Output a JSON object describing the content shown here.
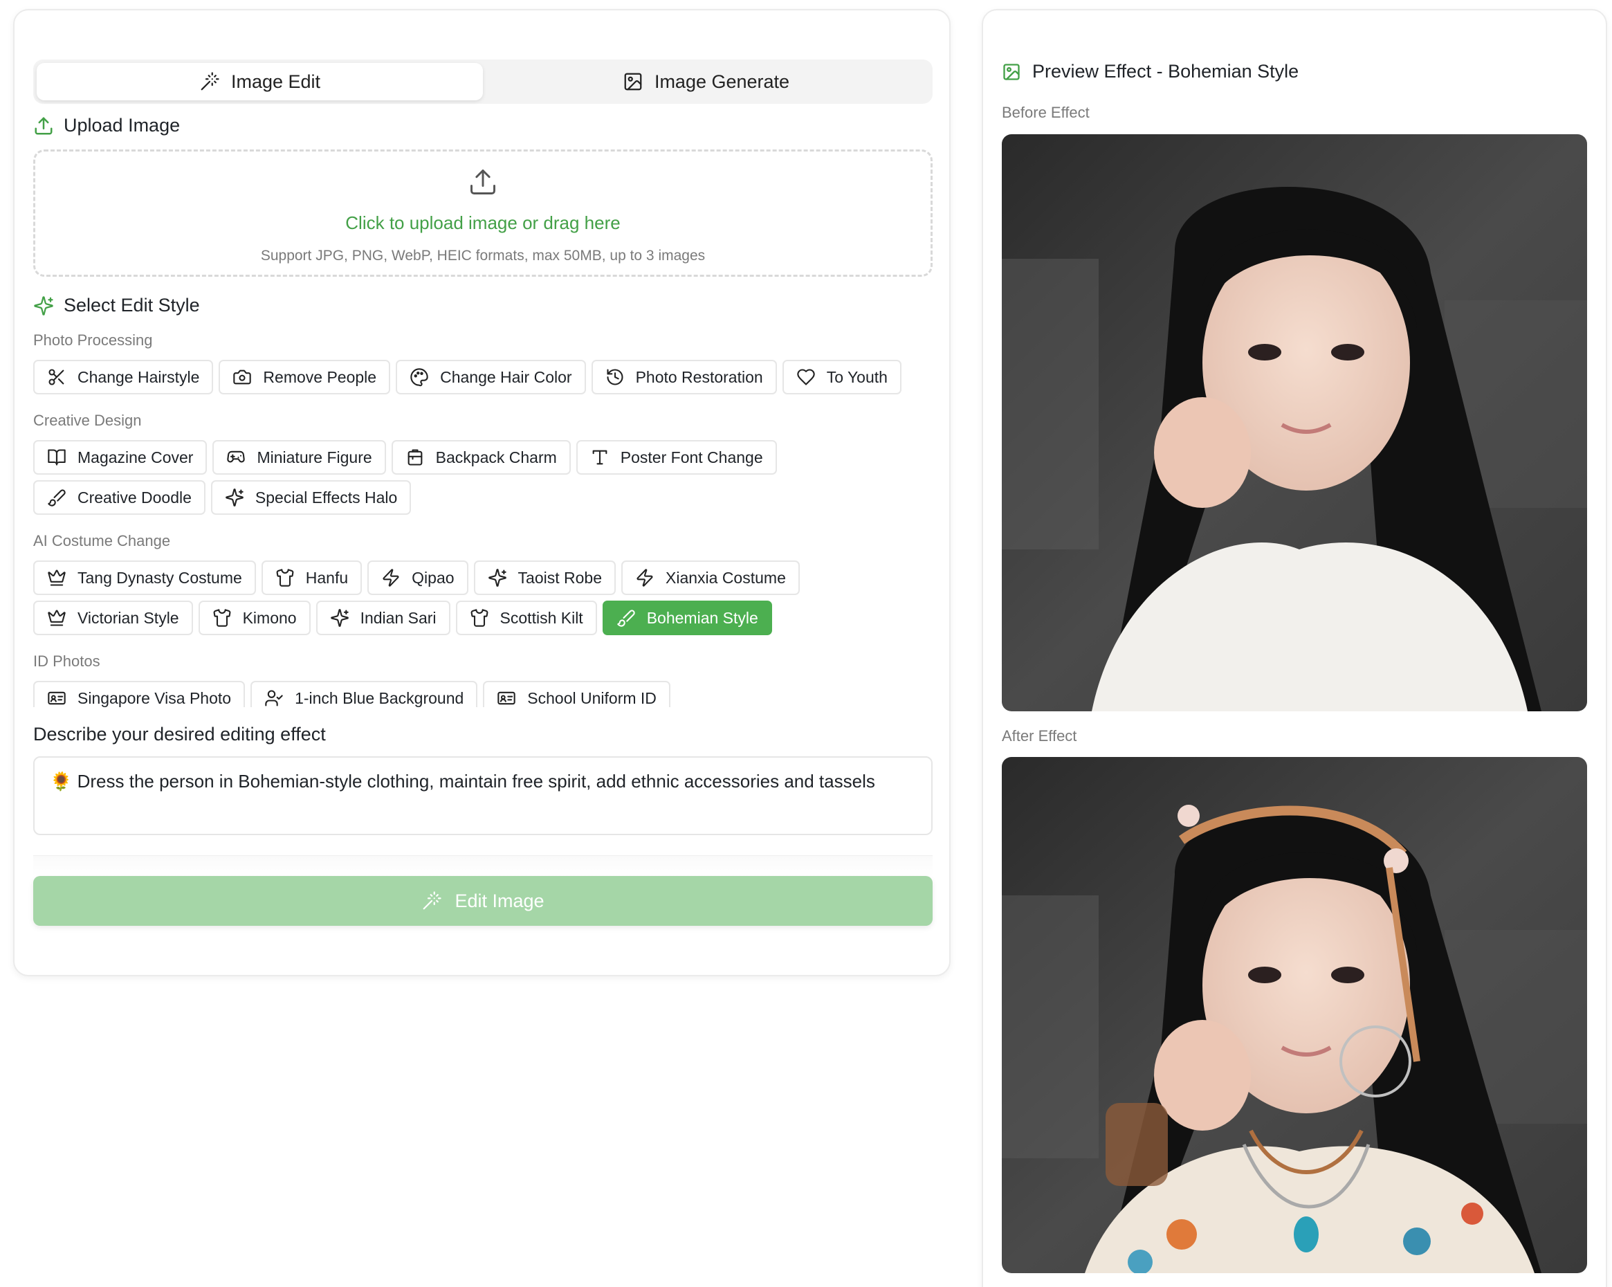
{
  "tabs": [
    {
      "label": "Image Edit",
      "icon": "magic-wand-icon",
      "active": true
    },
    {
      "label": "Image Generate",
      "icon": "image-icon",
      "active": false
    }
  ],
  "upload": {
    "title": "Upload Image",
    "main_text": "Click to upload image or drag here",
    "sub_text": "Support JPG, PNG, WebP, HEIC formats, max 50MB, up to 3 images"
  },
  "styles": {
    "title": "Select Edit Style",
    "groups": [
      {
        "label": "Photo Processing",
        "items": [
          {
            "label": "Change Hairstyle",
            "icon": "scissors-icon"
          },
          {
            "label": "Remove People",
            "icon": "camera-icon"
          },
          {
            "label": "Change Hair Color",
            "icon": "palette-icon"
          },
          {
            "label": "Photo Restoration",
            "icon": "history-icon"
          },
          {
            "label": "To Youth",
            "icon": "heart-icon"
          }
        ]
      },
      {
        "label": "Creative Design",
        "items": [
          {
            "label": "Magazine Cover",
            "icon": "book-open-icon"
          },
          {
            "label": "Miniature Figure",
            "icon": "gamepad-icon"
          },
          {
            "label": "Backpack Charm",
            "icon": "backpack-icon"
          },
          {
            "label": "Poster Font Change",
            "icon": "type-icon"
          },
          {
            "label": "Creative Doodle",
            "icon": "brush-icon"
          },
          {
            "label": "Special Effects Halo",
            "icon": "sparkles-icon"
          }
        ]
      },
      {
        "label": "AI Costume Change",
        "items": [
          {
            "label": "Tang Dynasty Costume",
            "icon": "crown-icon"
          },
          {
            "label": "Hanfu",
            "icon": "shirt-icon"
          },
          {
            "label": "Qipao",
            "icon": "zap-icon"
          },
          {
            "label": "Taoist Robe",
            "icon": "sparkles-icon"
          },
          {
            "label": "Xianxia Costume",
            "icon": "zap-icon"
          },
          {
            "label": "Victorian Style",
            "icon": "crown-icon"
          },
          {
            "label": "Kimono",
            "icon": "shirt-icon"
          },
          {
            "label": "Indian Sari",
            "icon": "sparkles-icon"
          },
          {
            "label": "Scottish Kilt",
            "icon": "shirt-icon"
          },
          {
            "label": "Bohemian Style",
            "icon": "brush-icon",
            "selected": true
          }
        ]
      },
      {
        "label": "ID Photos",
        "items": [
          {
            "label": "Singapore Visa Photo",
            "icon": "id-card-icon"
          },
          {
            "label": "1-inch Blue Background",
            "icon": "user-check-icon"
          },
          {
            "label": "School Uniform ID",
            "icon": "id-card-icon"
          }
        ]
      }
    ]
  },
  "description": {
    "label": "Describe your desired editing effect",
    "value": "🌻 Dress the person in Bohemian-style clothing, maintain free spirit, add ethnic accessories and tassels"
  },
  "edit_button": {
    "label": "Edit Image",
    "icon": "magic-wand-icon",
    "enabled": false
  },
  "preview": {
    "title": "Preview Effect - Bohemian Style",
    "before_label": "Before Effect",
    "after_label": "After Effect"
  },
  "colors": {
    "accent": "#4caf50",
    "accent_disabled": "#a5d6a7",
    "muted_text": "#7a7a7a"
  }
}
